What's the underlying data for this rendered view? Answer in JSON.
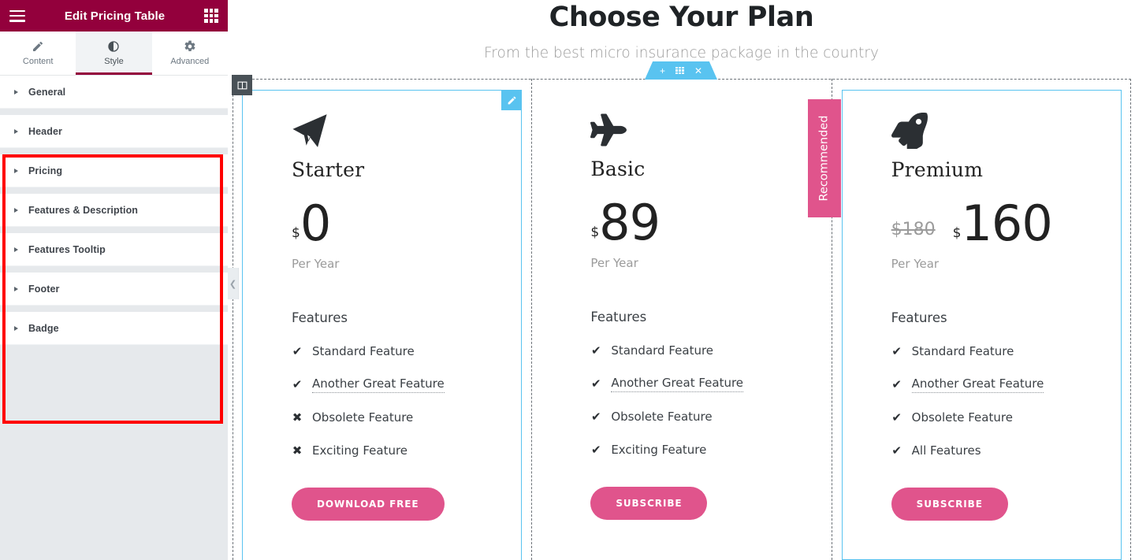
{
  "panel": {
    "title": "Edit Pricing Table",
    "menu_icon": "hamburger-icon",
    "apps_icon": "grid-apps-icon",
    "header_color": "#93003c",
    "tabs": [
      {
        "label": "Content",
        "icon": "pencil-icon",
        "active": false
      },
      {
        "label": "Style",
        "icon": "contrast-circle-icon",
        "active": true
      },
      {
        "label": "Advanced",
        "icon": "gear-icon",
        "active": false
      }
    ],
    "sections": [
      {
        "label": "General"
      },
      {
        "label": "Header"
      },
      {
        "label": "Pricing"
      },
      {
        "label": "Features & Description"
      },
      {
        "label": "Features Tooltip"
      },
      {
        "label": "Footer"
      },
      {
        "label": "Badge"
      }
    ],
    "collapse_icon": "chevron-left-icon",
    "highlight_color": "#ff0000"
  },
  "canvas": {
    "heading": "Choose Your Plan",
    "subheading": "From the best micro insurance package in the country",
    "section_toolbar": {
      "add_icon": "plus-icon",
      "drag_icon": "drag-dots-icon",
      "close_icon": "close-icon",
      "color": "#59c3f0"
    },
    "column_handle_icon": "columns-icon",
    "edit_widget_icon": "pencil-edit-icon",
    "accent_pink": "#e0548c",
    "accent_blue": "#59c3f0",
    "plans": [
      {
        "icon": "paper-plane-icon",
        "name": "Starter",
        "original_price": "",
        "currency": "$",
        "amount": "0",
        "period": "Per Year",
        "features_title": "Features",
        "features": [
          {
            "mark": "check",
            "text": "Standard Feature",
            "tooltip": false
          },
          {
            "mark": "check",
            "text": "Another Great Feature",
            "tooltip": true
          },
          {
            "mark": "cross",
            "text": "Obsolete Feature",
            "tooltip": false
          },
          {
            "mark": "cross",
            "text": "Exciting Feature",
            "tooltip": false
          }
        ],
        "cta": "DOWNLOAD FREE",
        "badge": "",
        "selected": true
      },
      {
        "icon": "airplane-icon",
        "name": "Basic",
        "original_price": "",
        "currency": "$",
        "amount": "89",
        "period": "Per Year",
        "features_title": "Features",
        "features": [
          {
            "mark": "check",
            "text": "Standard Feature",
            "tooltip": false
          },
          {
            "mark": "check",
            "text": "Another Great Feature",
            "tooltip": true
          },
          {
            "mark": "check",
            "text": "Obsolete Feature",
            "tooltip": false
          },
          {
            "mark": "check",
            "text": "Exciting Feature",
            "tooltip": false
          }
        ],
        "cta": "SUBSCRIBE",
        "badge": "Recommended",
        "selected": false
      },
      {
        "icon": "rocket-icon",
        "name": "Premium",
        "original_price": "$180",
        "currency": "$",
        "amount": "160",
        "period": "Per Year",
        "features_title": "Features",
        "features": [
          {
            "mark": "check",
            "text": "Standard Feature",
            "tooltip": false
          },
          {
            "mark": "check",
            "text": "Another Great Feature",
            "tooltip": true
          },
          {
            "mark": "check",
            "text": "Obsolete Feature",
            "tooltip": false
          },
          {
            "mark": "check",
            "text": "All Features",
            "tooltip": false
          }
        ],
        "cta": "SUBSCRIBE",
        "badge": "",
        "selected": true
      }
    ]
  }
}
